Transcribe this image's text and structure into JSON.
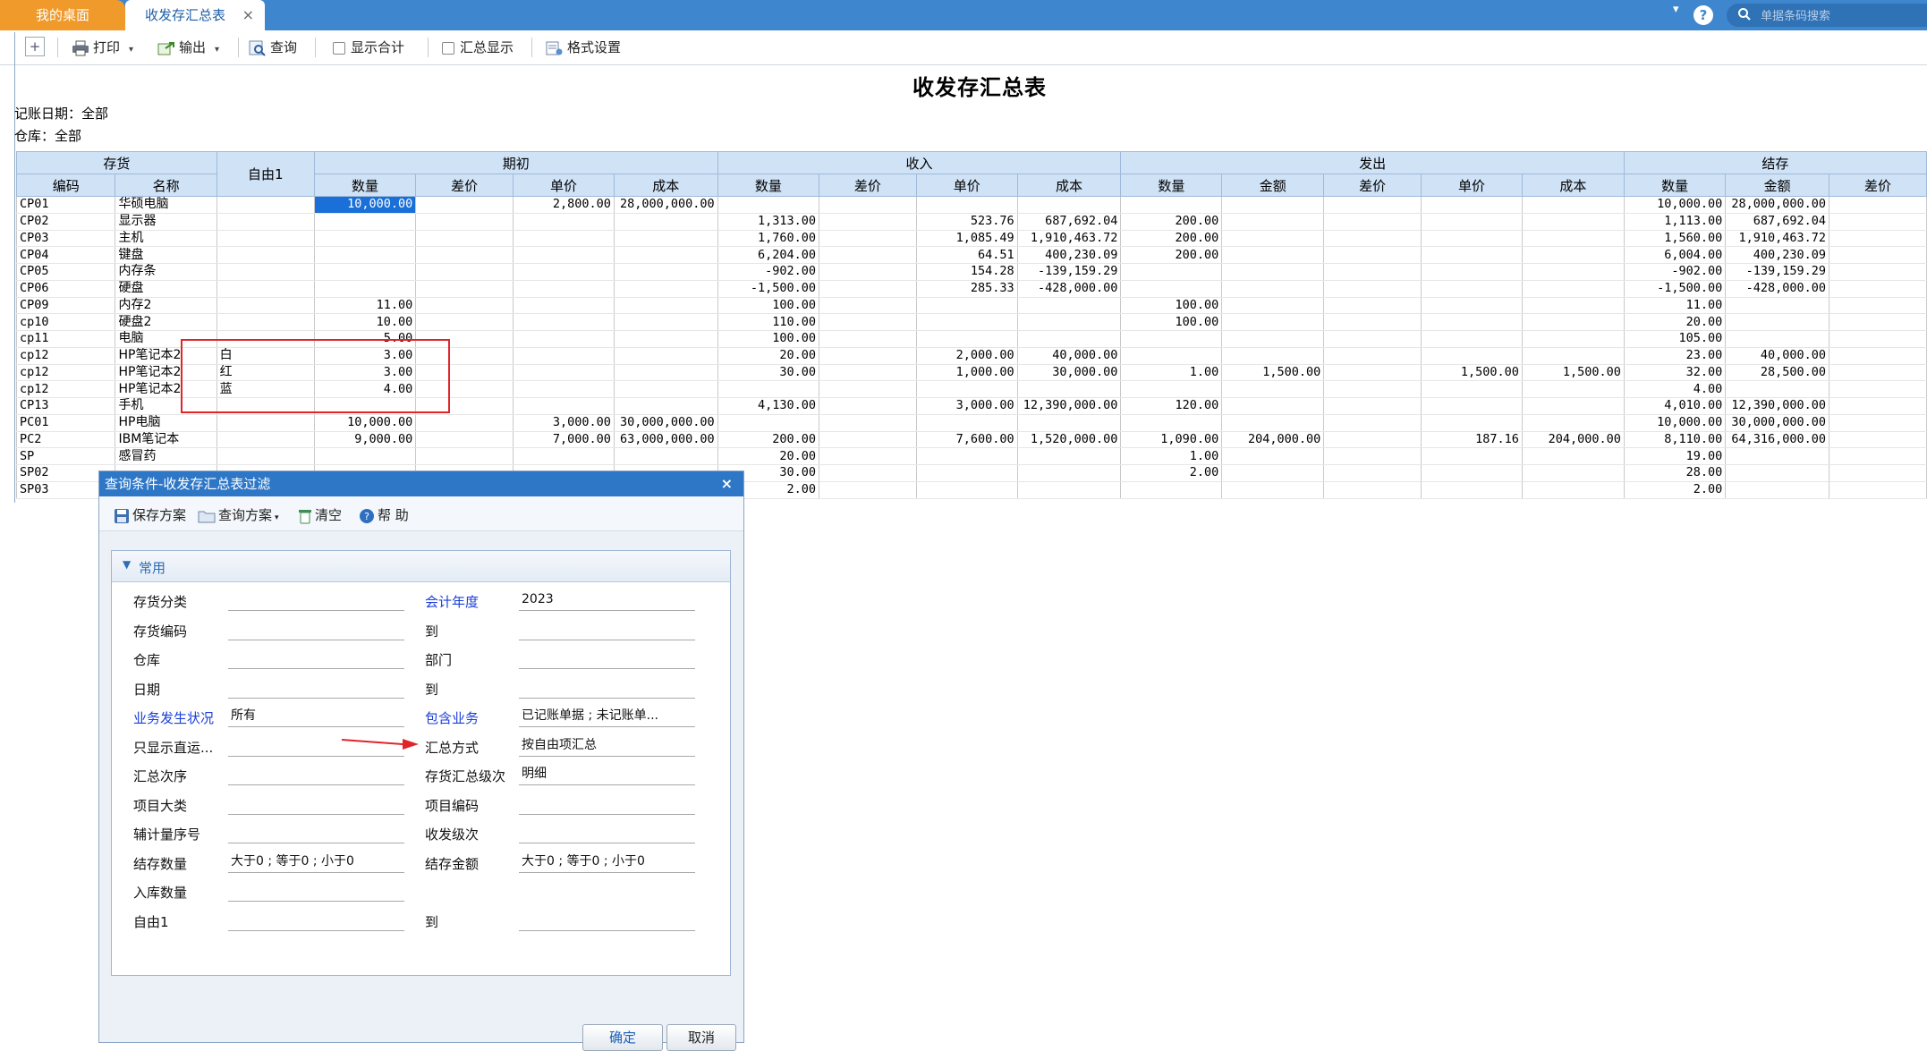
{
  "tabs": {
    "desktop": "我的桌面",
    "report": "收发存汇总表",
    "close": "×"
  },
  "top_right": {
    "dropdown": "▾",
    "help": "?",
    "search_icon": "search-icon",
    "search_placeholder": "单据条码搜索"
  },
  "toolbar": {
    "add": "+",
    "print": "打印",
    "export": "输出",
    "query": "查询",
    "show_total": "显示合计",
    "summary_display": "汇总显示",
    "format_settings": "格式设置",
    "caret": "▾"
  },
  "report": {
    "title": "收发存汇总表",
    "filter_date": "记账日期：全部",
    "filter_warehouse": "仓库：全部"
  },
  "grid": {
    "groups": {
      "inventory": "存货",
      "free1": "自由1",
      "opening": "期初",
      "receipt": "收入",
      "issue": "发出",
      "ending": "结存"
    },
    "cols": {
      "code": "编码",
      "name": "名称",
      "o_qty": "数量",
      "o_diff": "差价",
      "o_price": "单价",
      "o_cost": "成本",
      "r_qty": "数量",
      "r_diff": "差价",
      "r_price": "单价",
      "r_cost": "成本",
      "i_qty": "数量",
      "i_amt": "金额",
      "i_diff": "差价",
      "i_price": "单价",
      "i_cost": "成本",
      "e_qty": "数量",
      "e_amt": "金额",
      "e_diff": "差价"
    },
    "rows": [
      [
        "CP01",
        "华硕电脑",
        "",
        "10,000.00",
        "",
        "2,800.00",
        "28,000,000.00",
        "",
        "",
        "",
        "",
        "",
        "",
        "",
        "",
        "",
        "10,000.00",
        "28,000,000.00",
        ""
      ],
      [
        "CP02",
        "显示器",
        "",
        "",
        "",
        "",
        "",
        "1,313.00",
        "",
        "523.76",
        "687,692.04",
        "200.00",
        "",
        "",
        "",
        "",
        "1,113.00",
        "687,692.04",
        ""
      ],
      [
        "CP03",
        "主机",
        "",
        "",
        "",
        "",
        "",
        "1,760.00",
        "",
        "1,085.49",
        "1,910,463.72",
        "200.00",
        "",
        "",
        "",
        "",
        "1,560.00",
        "1,910,463.72",
        ""
      ],
      [
        "CP04",
        "键盘",
        "",
        "",
        "",
        "",
        "",
        "6,204.00",
        "",
        "64.51",
        "400,230.09",
        "200.00",
        "",
        "",
        "",
        "",
        "6,004.00",
        "400,230.09",
        ""
      ],
      [
        "CP05",
        "内存条",
        "",
        "",
        "",
        "",
        "",
        "-902.00",
        "",
        "154.28",
        "-139,159.29",
        "",
        "",
        "",
        "",
        "",
        "-902.00",
        "-139,159.29",
        ""
      ],
      [
        "CP06",
        "硬盘",
        "",
        "",
        "",
        "",
        "",
        "-1,500.00",
        "",
        "285.33",
        "-428,000.00",
        "",
        "",
        "",
        "",
        "",
        "-1,500.00",
        "-428,000.00",
        ""
      ],
      [
        "CP09",
        "内存2",
        "",
        "11.00",
        "",
        "",
        "",
        "100.00",
        "",
        "",
        "",
        "100.00",
        "",
        "",
        "",
        "",
        "11.00",
        "",
        ""
      ],
      [
        "cp10",
        "硬盘2",
        "",
        "10.00",
        "",
        "",
        "",
        "110.00",
        "",
        "",
        "",
        "100.00",
        "",
        "",
        "",
        "",
        "20.00",
        "",
        ""
      ],
      [
        "cp11",
        "电脑",
        "",
        "5.00",
        "",
        "",
        "",
        "100.00",
        "",
        "",
        "",
        "",
        "",
        "",
        "",
        "",
        "105.00",
        "",
        ""
      ],
      [
        "cp12",
        "HP笔记本2",
        "白",
        "3.00",
        "",
        "",
        "",
        "20.00",
        "",
        "2,000.00",
        "40,000.00",
        "",
        "",
        "",
        "",
        "",
        "23.00",
        "40,000.00",
        ""
      ],
      [
        "cp12",
        "HP笔记本2",
        "红",
        "3.00",
        "",
        "",
        "",
        "30.00",
        "",
        "1,000.00",
        "30,000.00",
        "1.00",
        "1,500.00",
        "",
        "1,500.00",
        "1,500.00",
        "32.00",
        "28,500.00",
        ""
      ],
      [
        "cp12",
        "HP笔记本2",
        "蓝",
        "4.00",
        "",
        "",
        "",
        "",
        "",
        "",
        "",
        "",
        "",
        "",
        "",
        "",
        "4.00",
        "",
        ""
      ],
      [
        "CP13",
        "手机",
        "",
        "",
        "",
        "",
        "",
        "4,130.00",
        "",
        "3,000.00",
        "12,390,000.00",
        "120.00",
        "",
        "",
        "",
        "",
        "4,010.00",
        "12,390,000.00",
        ""
      ],
      [
        "PC01",
        "HP电脑",
        "",
        "10,000.00",
        "",
        "3,000.00",
        "30,000,000.00",
        "",
        "",
        "",
        "",
        "",
        "",
        "",
        "",
        "",
        "10,000.00",
        "30,000,000.00",
        ""
      ],
      [
        "PC2",
        "IBM笔记本",
        "",
        "9,000.00",
        "",
        "7,000.00",
        "63,000,000.00",
        "200.00",
        "",
        "7,600.00",
        "1,520,000.00",
        "1,090.00",
        "204,000.00",
        "",
        "187.16",
        "204,000.00",
        "8,110.00",
        "64,316,000.00",
        ""
      ],
      [
        "SP",
        "感冒药",
        "",
        "",
        "",
        "",
        "",
        "20.00",
        "",
        "",
        "",
        "1.00",
        "",
        "",
        "",
        "",
        "19.00",
        "",
        ""
      ],
      [
        "SP02",
        "",
        "",
        "",
        "",
        "",
        "",
        "30.00",
        "",
        "",
        "",
        "2.00",
        "",
        "",
        "",
        "",
        "28.00",
        "",
        ""
      ],
      [
        "SP03",
        "",
        "",
        "",
        "",
        "",
        "",
        "2.00",
        "",
        "",
        "",
        "",
        "",
        "",
        "",
        "",
        "2.00",
        "",
        ""
      ]
    ]
  },
  "dialog": {
    "title": "查询条件-收发存汇总表过滤",
    "close": "×",
    "tools": {
      "save_plan": "保存方案",
      "query_plan": "查询方案",
      "clear": "清空",
      "help": "帮 助"
    },
    "group": "常用",
    "fields": {
      "inv_class": "存货分类",
      "fiscal_year": "会计年度",
      "fiscal_year_value": "2023",
      "inv_code": "存货编码",
      "to": "到",
      "warehouse": "仓库",
      "department": "部门",
      "date": "日期",
      "biz_status": "业务发生状况",
      "biz_status_value": "所有",
      "include_biz": "包含业务",
      "include_biz_value": "已记账单据 ; 未记账单...",
      "show_direct": "只显示直运...",
      "summary_method": "汇总方式",
      "summary_method_value": "按自由项汇总",
      "summary_order": "汇总次序",
      "inv_level": "存货汇总级次",
      "inv_level_value": "明细",
      "project_class": "项目大类",
      "project_code": "项目编码",
      "aux_unit_no": "辅计量序号",
      "rs_level": "收发级次",
      "end_qty": "结存数量",
      "end_qty_value": "大于0 ; 等于0 ; 小于0",
      "end_amt": "结存金额",
      "end_amt_value": "大于0 ; 等于0 ; 小于0",
      "in_qty": "入库数量",
      "free1": "自由1"
    },
    "buttons": {
      "ok": "确定",
      "cancel": "取消"
    }
  }
}
